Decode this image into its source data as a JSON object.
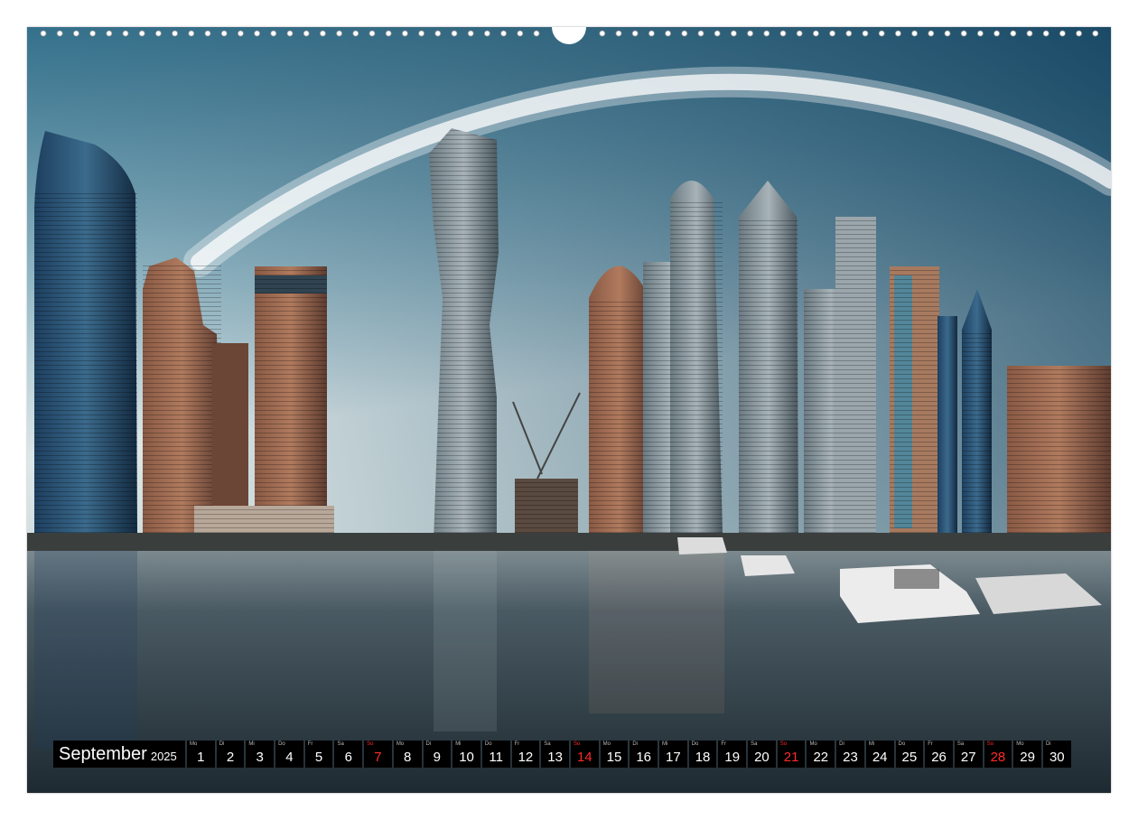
{
  "calendar": {
    "month": "September",
    "year": "2025",
    "days": [
      {
        "wd": "Mo",
        "d": "1",
        "sun": false
      },
      {
        "wd": "Di",
        "d": "2",
        "sun": false
      },
      {
        "wd": "Mi",
        "d": "3",
        "sun": false
      },
      {
        "wd": "Do",
        "d": "4",
        "sun": false
      },
      {
        "wd": "Fr",
        "d": "5",
        "sun": false
      },
      {
        "wd": "Sa",
        "d": "6",
        "sun": false
      },
      {
        "wd": "So",
        "d": "7",
        "sun": true
      },
      {
        "wd": "Mo",
        "d": "8",
        "sun": false
      },
      {
        "wd": "Di",
        "d": "9",
        "sun": false
      },
      {
        "wd": "Mi",
        "d": "10",
        "sun": false
      },
      {
        "wd": "Do",
        "d": "11",
        "sun": false
      },
      {
        "wd": "Fr",
        "d": "12",
        "sun": false
      },
      {
        "wd": "Sa",
        "d": "13",
        "sun": false
      },
      {
        "wd": "So",
        "d": "14",
        "sun": true
      },
      {
        "wd": "Mo",
        "d": "15",
        "sun": false
      },
      {
        "wd": "Di",
        "d": "16",
        "sun": false
      },
      {
        "wd": "Mi",
        "d": "17",
        "sun": false
      },
      {
        "wd": "Do",
        "d": "18",
        "sun": false
      },
      {
        "wd": "Fr",
        "d": "19",
        "sun": false
      },
      {
        "wd": "Sa",
        "d": "20",
        "sun": false
      },
      {
        "wd": "So",
        "d": "21",
        "sun": true
      },
      {
        "wd": "Mo",
        "d": "22",
        "sun": false
      },
      {
        "wd": "Di",
        "d": "23",
        "sun": false
      },
      {
        "wd": "Mi",
        "d": "24",
        "sun": false
      },
      {
        "wd": "Do",
        "d": "25",
        "sun": false
      },
      {
        "wd": "Fr",
        "d": "26",
        "sun": false
      },
      {
        "wd": "Sa",
        "d": "27",
        "sun": false
      },
      {
        "wd": "So",
        "d": "28",
        "sun": true
      },
      {
        "wd": "Mo",
        "d": "29",
        "sun": false
      },
      {
        "wd": "Di",
        "d": "30",
        "sun": false
      }
    ]
  },
  "colors": {
    "sky_top": "#1f4f6e",
    "sky_glow": "#d9e6ea",
    "water": "#2b3b45",
    "strip_bg": "#000000",
    "sunday": "#ff2a2a"
  },
  "icons": [
    "spiral-binding-hole-icon"
  ]
}
